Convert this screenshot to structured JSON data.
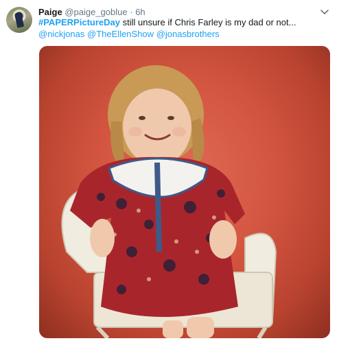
{
  "tweet": {
    "author_name": "Paige",
    "author_handle": "@paige_goblue",
    "separator": "·",
    "timestamp": "6h",
    "hashtag": "#PAPERPictureDay",
    "text": " still unsure if Chris Farley is my dad or not... ",
    "mentions": [
      "@nickjonas",
      "@TheEllenShow",
      "@jonasbrothers"
    ]
  },
  "colors": {
    "link": "#1da1f2",
    "muted": "#657786",
    "text": "#14171a"
  },
  "icons": {
    "menu": "chevron-down-icon"
  }
}
